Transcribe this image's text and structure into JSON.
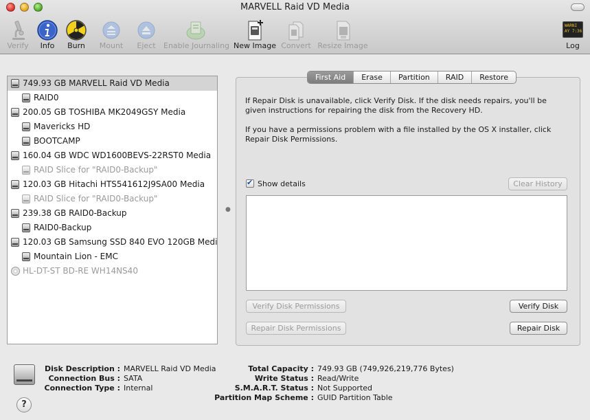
{
  "window": {
    "title": "MARVELL Raid VD Media"
  },
  "toolbar": {
    "verify": "Verify",
    "info": "Info",
    "burn": "Burn",
    "mount": "Mount",
    "eject": "Eject",
    "enable_journaling": "Enable Journaling",
    "new_image": "New Image",
    "convert": "Convert",
    "resize_image": "Resize Image",
    "log": "Log",
    "log_icon_text_1": "WARNI",
    "log_icon_text_2": "AY 7:36"
  },
  "disks": [
    {
      "label": "749.93 GB MARVELL Raid VD Media",
      "level": 0,
      "selected": true,
      "dim": false,
      "icon": "hard-disk-icon"
    },
    {
      "label": "RAID0",
      "level": 1,
      "selected": false,
      "dim": false,
      "icon": "volume-icon"
    },
    {
      "label": "200.05 GB TOSHIBA MK2049GSY Media",
      "level": 0,
      "selected": false,
      "dim": false,
      "icon": "hard-disk-icon"
    },
    {
      "label": "Mavericks HD",
      "level": 1,
      "selected": false,
      "dim": false,
      "icon": "volume-icon"
    },
    {
      "label": "BOOTCAMP",
      "level": 1,
      "selected": false,
      "dim": false,
      "icon": "volume-icon"
    },
    {
      "label": "160.04 GB WDC WD1600BEVS-22RST0 Media",
      "level": 0,
      "selected": false,
      "dim": false,
      "icon": "hard-disk-icon"
    },
    {
      "label": "RAID Slice for \"RAID0-Backup\"",
      "level": 1,
      "selected": false,
      "dim": true,
      "icon": "volume-icon"
    },
    {
      "label": "120.03 GB Hitachi HTS541612J9SA00 Media",
      "level": 0,
      "selected": false,
      "dim": false,
      "icon": "hard-disk-icon"
    },
    {
      "label": "RAID Slice for \"RAID0-Backup\"",
      "level": 1,
      "selected": false,
      "dim": true,
      "icon": "volume-icon"
    },
    {
      "label": "239.38 GB RAID0-Backup",
      "level": 0,
      "selected": false,
      "dim": false,
      "icon": "hard-disk-icon"
    },
    {
      "label": "RAID0-Backup",
      "level": 1,
      "selected": false,
      "dim": false,
      "icon": "volume-icon"
    },
    {
      "label": "120.03 GB Samsung SSD 840 EVO 120GB Media",
      "level": 0,
      "selected": false,
      "dim": false,
      "icon": "hard-disk-icon"
    },
    {
      "label": "Mountain Lion - EMC",
      "level": 1,
      "selected": false,
      "dim": false,
      "icon": "volume-icon"
    },
    {
      "label": "HL-DT-ST BD-RE WH14NS40",
      "level": 0,
      "selected": false,
      "dim": true,
      "icon": "optical-drive-icon"
    }
  ],
  "tabs": [
    {
      "label": "First Aid",
      "active": true
    },
    {
      "label": "Erase",
      "active": false
    },
    {
      "label": "Partition",
      "active": false
    },
    {
      "label": "RAID",
      "active": false
    },
    {
      "label": "Restore",
      "active": false
    }
  ],
  "first_aid": {
    "para1": "If Repair Disk is unavailable, click Verify Disk. If the disk needs repairs, you'll be given instructions for repairing the disk from the Recovery HD.",
    "para2": "If you have a permissions problem with a file installed by the OS X installer, click Repair Disk Permissions.",
    "show_details": "Show details",
    "show_details_checked": true,
    "clear_history": "Clear History",
    "verify_permissions": "Verify Disk Permissions",
    "verify_disk": "Verify Disk",
    "repair_permissions": "Repair Disk Permissions",
    "repair_disk": "Repair Disk"
  },
  "info": {
    "disk_description_key": "Disk Description :",
    "disk_description": "MARVELL Raid VD Media",
    "connection_bus_key": "Connection Bus :",
    "connection_bus": "SATA",
    "connection_type_key": "Connection Type :",
    "connection_type": "Internal",
    "total_capacity_key": "Total Capacity :",
    "total_capacity": "749.93 GB (749,926,219,776 Bytes)",
    "write_status_key": "Write Status :",
    "write_status": "Read/Write",
    "smart_status_key": "S.M.A.R.T. Status :",
    "smart_status": "Not Supported",
    "partition_map_key": "Partition Map Scheme :",
    "partition_map": "GUID Partition Table"
  },
  "help": {
    "label": "?"
  }
}
